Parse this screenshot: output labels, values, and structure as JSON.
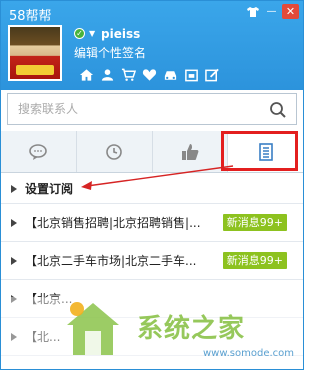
{
  "window": {
    "title": "58帮帮",
    "controls": [
      "shirt-icon",
      "minimize-icon",
      "close-icon"
    ]
  },
  "profile": {
    "status": "online",
    "username": "pieiss",
    "signature": "编辑个性签名"
  },
  "services": [
    "home-icon",
    "user-icon",
    "cart-icon",
    "heart-icon",
    "car-icon",
    "calendar-icon",
    "edit-icon"
  ],
  "search": {
    "placeholder": "搜索联系人"
  },
  "tabs": [
    {
      "icon": "chat-bubble-icon",
      "active": false
    },
    {
      "icon": "clock-icon",
      "active": false
    },
    {
      "icon": "thumbs-up-icon",
      "active": false
    },
    {
      "icon": "list-document-icon",
      "active": true
    }
  ],
  "list": {
    "items": [
      {
        "label": "设置订阅",
        "badge": ""
      },
      {
        "label": "【北京销售招聘|北京招聘销售|...",
        "badge": "新消息99+"
      },
      {
        "label": "【北京二手车市场|北京二手车...",
        "badge": "新消息99+"
      },
      {
        "label": "【北京...",
        "badge": ""
      },
      {
        "label": "【北...",
        "badge": ""
      }
    ]
  },
  "watermark": {
    "text": "系统之家",
    "url": "www.somode.com"
  },
  "colors": {
    "header": "#2c93dc",
    "badge": "#8dc21f",
    "highlight": "#e31f1f"
  }
}
